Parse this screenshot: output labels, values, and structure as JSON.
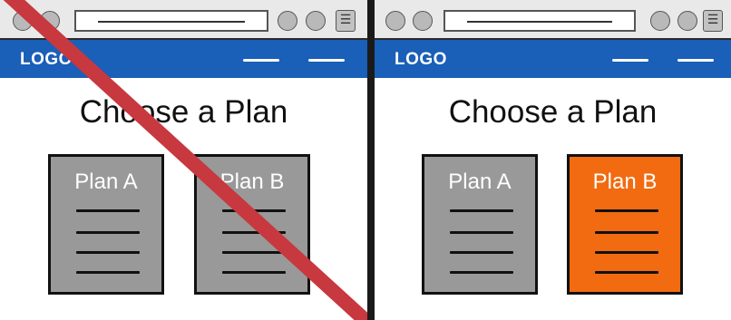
{
  "mockups": [
    {
      "logo": "LOGO",
      "heading": "Choose a Plan",
      "plans": [
        {
          "title": "Plan A",
          "color": "#999999"
        },
        {
          "title": "Plan B",
          "color": "#999999"
        }
      ],
      "crossed_out": true
    },
    {
      "logo": "LOGO",
      "heading": "Choose a Plan",
      "plans": [
        {
          "title": "Plan A",
          "color": "#999999"
        },
        {
          "title": "Plan B",
          "color": "#f26b10"
        }
      ],
      "crossed_out": false
    }
  ],
  "colors": {
    "nav": "#1a5fb8",
    "card_default": "#999999",
    "card_highlight": "#f26b10",
    "slash": "#c7383f"
  }
}
